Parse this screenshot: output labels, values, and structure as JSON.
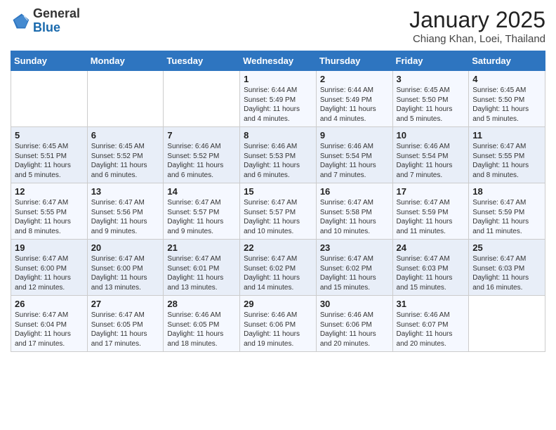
{
  "header": {
    "logo_general": "General",
    "logo_blue": "Blue",
    "month": "January 2025",
    "location": "Chiang Khan, Loei, Thailand"
  },
  "weekdays": [
    "Sunday",
    "Monday",
    "Tuesday",
    "Wednesday",
    "Thursday",
    "Friday",
    "Saturday"
  ],
  "weeks": [
    [
      {
        "day": "",
        "info": ""
      },
      {
        "day": "",
        "info": ""
      },
      {
        "day": "",
        "info": ""
      },
      {
        "day": "1",
        "info": "Sunrise: 6:44 AM\nSunset: 5:49 PM\nDaylight: 11 hours\nand 4 minutes."
      },
      {
        "day": "2",
        "info": "Sunrise: 6:44 AM\nSunset: 5:49 PM\nDaylight: 11 hours\nand 4 minutes."
      },
      {
        "day": "3",
        "info": "Sunrise: 6:45 AM\nSunset: 5:50 PM\nDaylight: 11 hours\nand 5 minutes."
      },
      {
        "day": "4",
        "info": "Sunrise: 6:45 AM\nSunset: 5:50 PM\nDaylight: 11 hours\nand 5 minutes."
      }
    ],
    [
      {
        "day": "5",
        "info": "Sunrise: 6:45 AM\nSunset: 5:51 PM\nDaylight: 11 hours\nand 5 minutes."
      },
      {
        "day": "6",
        "info": "Sunrise: 6:45 AM\nSunset: 5:52 PM\nDaylight: 11 hours\nand 6 minutes."
      },
      {
        "day": "7",
        "info": "Sunrise: 6:46 AM\nSunset: 5:52 PM\nDaylight: 11 hours\nand 6 minutes."
      },
      {
        "day": "8",
        "info": "Sunrise: 6:46 AM\nSunset: 5:53 PM\nDaylight: 11 hours\nand 6 minutes."
      },
      {
        "day": "9",
        "info": "Sunrise: 6:46 AM\nSunset: 5:54 PM\nDaylight: 11 hours\nand 7 minutes."
      },
      {
        "day": "10",
        "info": "Sunrise: 6:46 AM\nSunset: 5:54 PM\nDaylight: 11 hours\nand 7 minutes."
      },
      {
        "day": "11",
        "info": "Sunrise: 6:47 AM\nSunset: 5:55 PM\nDaylight: 11 hours\nand 8 minutes."
      }
    ],
    [
      {
        "day": "12",
        "info": "Sunrise: 6:47 AM\nSunset: 5:55 PM\nDaylight: 11 hours\nand 8 minutes."
      },
      {
        "day": "13",
        "info": "Sunrise: 6:47 AM\nSunset: 5:56 PM\nDaylight: 11 hours\nand 9 minutes."
      },
      {
        "day": "14",
        "info": "Sunrise: 6:47 AM\nSunset: 5:57 PM\nDaylight: 11 hours\nand 9 minutes."
      },
      {
        "day": "15",
        "info": "Sunrise: 6:47 AM\nSunset: 5:57 PM\nDaylight: 11 hours\nand 10 minutes."
      },
      {
        "day": "16",
        "info": "Sunrise: 6:47 AM\nSunset: 5:58 PM\nDaylight: 11 hours\nand 10 minutes."
      },
      {
        "day": "17",
        "info": "Sunrise: 6:47 AM\nSunset: 5:59 PM\nDaylight: 11 hours\nand 11 minutes."
      },
      {
        "day": "18",
        "info": "Sunrise: 6:47 AM\nSunset: 5:59 PM\nDaylight: 11 hours\nand 11 minutes."
      }
    ],
    [
      {
        "day": "19",
        "info": "Sunrise: 6:47 AM\nSunset: 6:00 PM\nDaylight: 11 hours\nand 12 minutes."
      },
      {
        "day": "20",
        "info": "Sunrise: 6:47 AM\nSunset: 6:00 PM\nDaylight: 11 hours\nand 13 minutes."
      },
      {
        "day": "21",
        "info": "Sunrise: 6:47 AM\nSunset: 6:01 PM\nDaylight: 11 hours\nand 13 minutes."
      },
      {
        "day": "22",
        "info": "Sunrise: 6:47 AM\nSunset: 6:02 PM\nDaylight: 11 hours\nand 14 minutes."
      },
      {
        "day": "23",
        "info": "Sunrise: 6:47 AM\nSunset: 6:02 PM\nDaylight: 11 hours\nand 15 minutes."
      },
      {
        "day": "24",
        "info": "Sunrise: 6:47 AM\nSunset: 6:03 PM\nDaylight: 11 hours\nand 15 minutes."
      },
      {
        "day": "25",
        "info": "Sunrise: 6:47 AM\nSunset: 6:03 PM\nDaylight: 11 hours\nand 16 minutes."
      }
    ],
    [
      {
        "day": "26",
        "info": "Sunrise: 6:47 AM\nSunset: 6:04 PM\nDaylight: 11 hours\nand 17 minutes."
      },
      {
        "day": "27",
        "info": "Sunrise: 6:47 AM\nSunset: 6:05 PM\nDaylight: 11 hours\nand 17 minutes."
      },
      {
        "day": "28",
        "info": "Sunrise: 6:46 AM\nSunset: 6:05 PM\nDaylight: 11 hours\nand 18 minutes."
      },
      {
        "day": "29",
        "info": "Sunrise: 6:46 AM\nSunset: 6:06 PM\nDaylight: 11 hours\nand 19 minutes."
      },
      {
        "day": "30",
        "info": "Sunrise: 6:46 AM\nSunset: 6:06 PM\nDaylight: 11 hours\nand 20 minutes."
      },
      {
        "day": "31",
        "info": "Sunrise: 6:46 AM\nSunset: 6:07 PM\nDaylight: 11 hours\nand 20 minutes."
      },
      {
        "day": "",
        "info": ""
      }
    ]
  ]
}
